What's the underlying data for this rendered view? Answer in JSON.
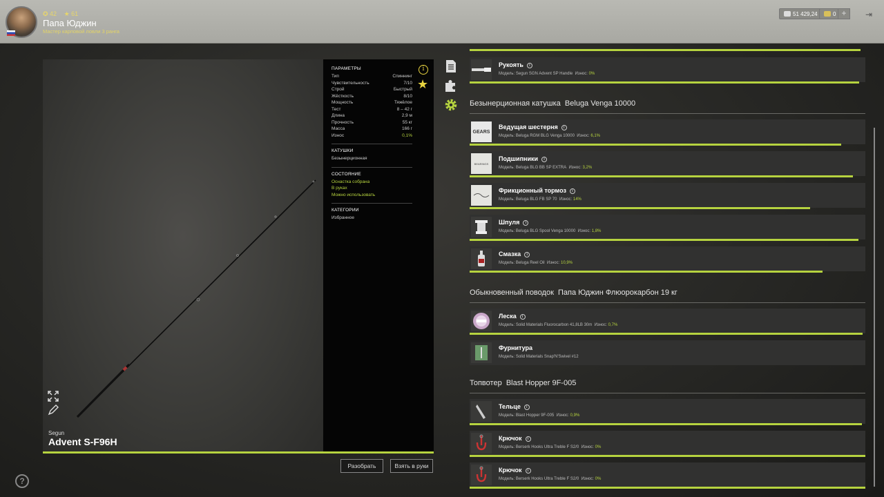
{
  "player": {
    "level": "42",
    "rating": "61",
    "name": "Папа Юджин",
    "title": "Мастер карповой ловли 3 ранга"
  },
  "wallet": {
    "silver": "51 429,24",
    "gold": "0",
    "plus": "+"
  },
  "rod": {
    "brand": "Segun",
    "name": "Advent S-F96H",
    "params_header": "ПАРАМЕТРЫ",
    "params": [
      {
        "label": "Тип",
        "value": "Спиннинг"
      },
      {
        "label": "Чувствительность",
        "value": "7/10"
      },
      {
        "label": "Строй",
        "value": "Быстрый"
      },
      {
        "label": "Жёсткость",
        "value": "8/10"
      },
      {
        "label": "Мощность",
        "value": "Тяжёлое"
      },
      {
        "label": "Тест",
        "value": "8 – 42 г"
      },
      {
        "label": "Длина",
        "value": "2,9 м"
      },
      {
        "label": "Прочность",
        "value": "55 кг"
      },
      {
        "label": "Масса",
        "value": "166 г"
      },
      {
        "label": "Износ",
        "value": "0,1%"
      }
    ],
    "reels_header": "КАТУШКИ",
    "reels_value": "Безынерционная",
    "state_header": "СОСТОЯНИЕ",
    "state": [
      "Оснастка собрана",
      "В руках",
      "Можно использовать"
    ],
    "category_header": "КАТЕГОРИИ",
    "category_value": "Избранное"
  },
  "buttons": {
    "disassemble": "Разобрать",
    "take": "Взять в руки"
  },
  "model_label": "Модель:",
  "wear_label": "Износ:",
  "handle": {
    "name": "Рукоять",
    "model": "Segun SGN Advent SP Handle",
    "wear": "0%",
    "wear_fraction": 0.985
  },
  "reel": {
    "section": "Безынерционная катушка",
    "name": "Beluga Venga 10000",
    "parts": [
      {
        "name": "Ведущая шестерня",
        "model": "Beluga RGM BLG Venga 10000",
        "wear": "6,1%",
        "wear_fraction": 0.939,
        "thumb": "GEARS"
      },
      {
        "name": "Подшипники",
        "model": "Beluga BLG BB SP EXTRA",
        "wear": "3,2%",
        "wear_fraction": 0.968,
        "thumb": "BEARINGS"
      },
      {
        "name": "Фрикционный тормоз",
        "model": "Beluga BLG FB SP 70",
        "wear": "14%",
        "wear_fraction": 0.86,
        "thumb": "drag"
      },
      {
        "name": "Шпуля",
        "model": "Beluga BLG Spool Venga 10000",
        "wear": "1,8%",
        "wear_fraction": 0.982,
        "thumb": "spool"
      },
      {
        "name": "Смазка",
        "model": "Beluga Reel Oil",
        "wear": "10,9%",
        "wear_fraction": 0.891,
        "thumb": "oil"
      }
    ]
  },
  "leader": {
    "section": "Обыкновенный поводок",
    "name": "Папа Юджин Флюорокарбон 19 кг",
    "parts": [
      {
        "name": "Леска",
        "model": "Solid Materials Fluorocarbon 41,8LB 30m",
        "wear": "0,7%",
        "wear_fraction": 0.993
      },
      {
        "name": "Фурнитура",
        "model": "Solid Materials Snap'N'Swivel #12",
        "wear": "",
        "wear_fraction": 0
      }
    ]
  },
  "lure": {
    "section": "Топвотер",
    "name": "Blast Hopper 9F-005",
    "parts": [
      {
        "name": "Тельце",
        "model": "Blast Hopper 9F-005",
        "wear": "0,9%",
        "wear_fraction": 0.991
      },
      {
        "name": "Крючок",
        "model": "Berserk Hooks Ultra Treble F S2/0",
        "wear": "0%",
        "wear_fraction": 1
      },
      {
        "name": "Крючок",
        "model": "Berserk Hooks Ultra Treble F S2/0",
        "wear": "0%",
        "wear_fraction": 1
      }
    ]
  },
  "help": "?",
  "info_glyph": "i",
  "colors": {
    "accent": "#b6d33f",
    "star": "#e8d340"
  }
}
